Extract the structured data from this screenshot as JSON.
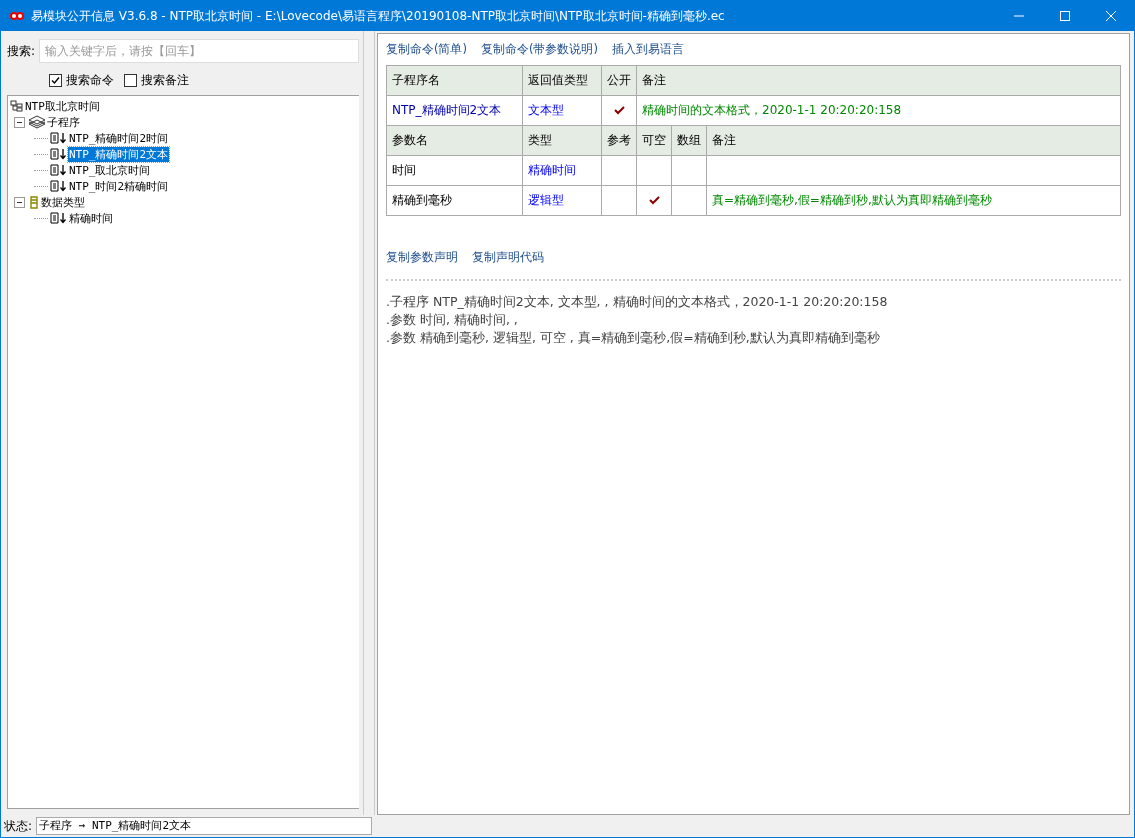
{
  "window": {
    "title": "易模块公开信息 V3.6.8 - NTP取北京时间 - E:\\Lovecode\\易语言程序\\20190108-NTP取北京时间\\NTP取北京时间-精确到毫秒.ec"
  },
  "search": {
    "label": "搜索:",
    "placeholder": "输入关键字后，请按【回车】",
    "options": [
      {
        "label": "搜索命令",
        "checked": true
      },
      {
        "label": "搜索备注",
        "checked": false
      }
    ]
  },
  "tree": [
    {
      "label": "NTP取北京时间",
      "kind": "module",
      "selected": false,
      "children": [
        {
          "label": "子程序",
          "kind": "group",
          "expanded": true,
          "selected": false,
          "children": [
            {
              "label": "NTP_精确时间2时间",
              "kind": "sub",
              "selected": false
            },
            {
              "label": "NTP_精确时间2文本",
              "kind": "sub",
              "selected": true
            },
            {
              "label": "NTP_取北京时间",
              "kind": "sub",
              "selected": false
            },
            {
              "label": "NTP_时间2精确时间",
              "kind": "sub",
              "selected": false
            }
          ]
        },
        {
          "label": "数据类型",
          "kind": "type",
          "expanded": true,
          "selected": false,
          "children": [
            {
              "label": "精确时间",
              "kind": "sub",
              "selected": false
            }
          ]
        }
      ]
    }
  ],
  "top_links": [
    "复制命令(简单)",
    "复制命令(带参数说明)",
    "插入到易语言"
  ],
  "sub_table": {
    "columns": [
      "子程序名",
      "返回值类型",
      "公开",
      "备注"
    ],
    "rows": [
      {
        "name": "NTP_精确时间2文本",
        "type": "文本型",
        "public": true,
        "note": "精确时间的文本格式，2020-1-1 20:20:20:158"
      }
    ]
  },
  "param_table": {
    "columns": [
      "参数名",
      "类型",
      "参考",
      "可空",
      "数组",
      "备注"
    ],
    "rows": [
      {
        "name": "时间",
        "type": "精确时间",
        "ref": false,
        "optional": false,
        "array": false,
        "note": ""
      },
      {
        "name": "精确到毫秒",
        "type": "逻辑型",
        "ref": false,
        "optional": true,
        "array": false,
        "note": "真=精确到毫秒,假=精确到秒,默认为真即精确到毫秒"
      }
    ]
  },
  "bottom_links": [
    "复制参数声明",
    "复制声明代码"
  ],
  "code_lines": [
    ".子程序 NTP_精确时间2文本, 文本型, , 精确时间的文本格式，2020-1-1 20:20:20:158",
    ".参数 时间, 精确时间, ,",
    ".参数 精确到毫秒, 逻辑型, 可空 , 真=精确到毫秒,假=精确到秒,默认为真即精确到毫秒"
  ],
  "status_bar": {
    "label": "状态:",
    "value": "子程序 → NTP_精确时间2文本"
  }
}
